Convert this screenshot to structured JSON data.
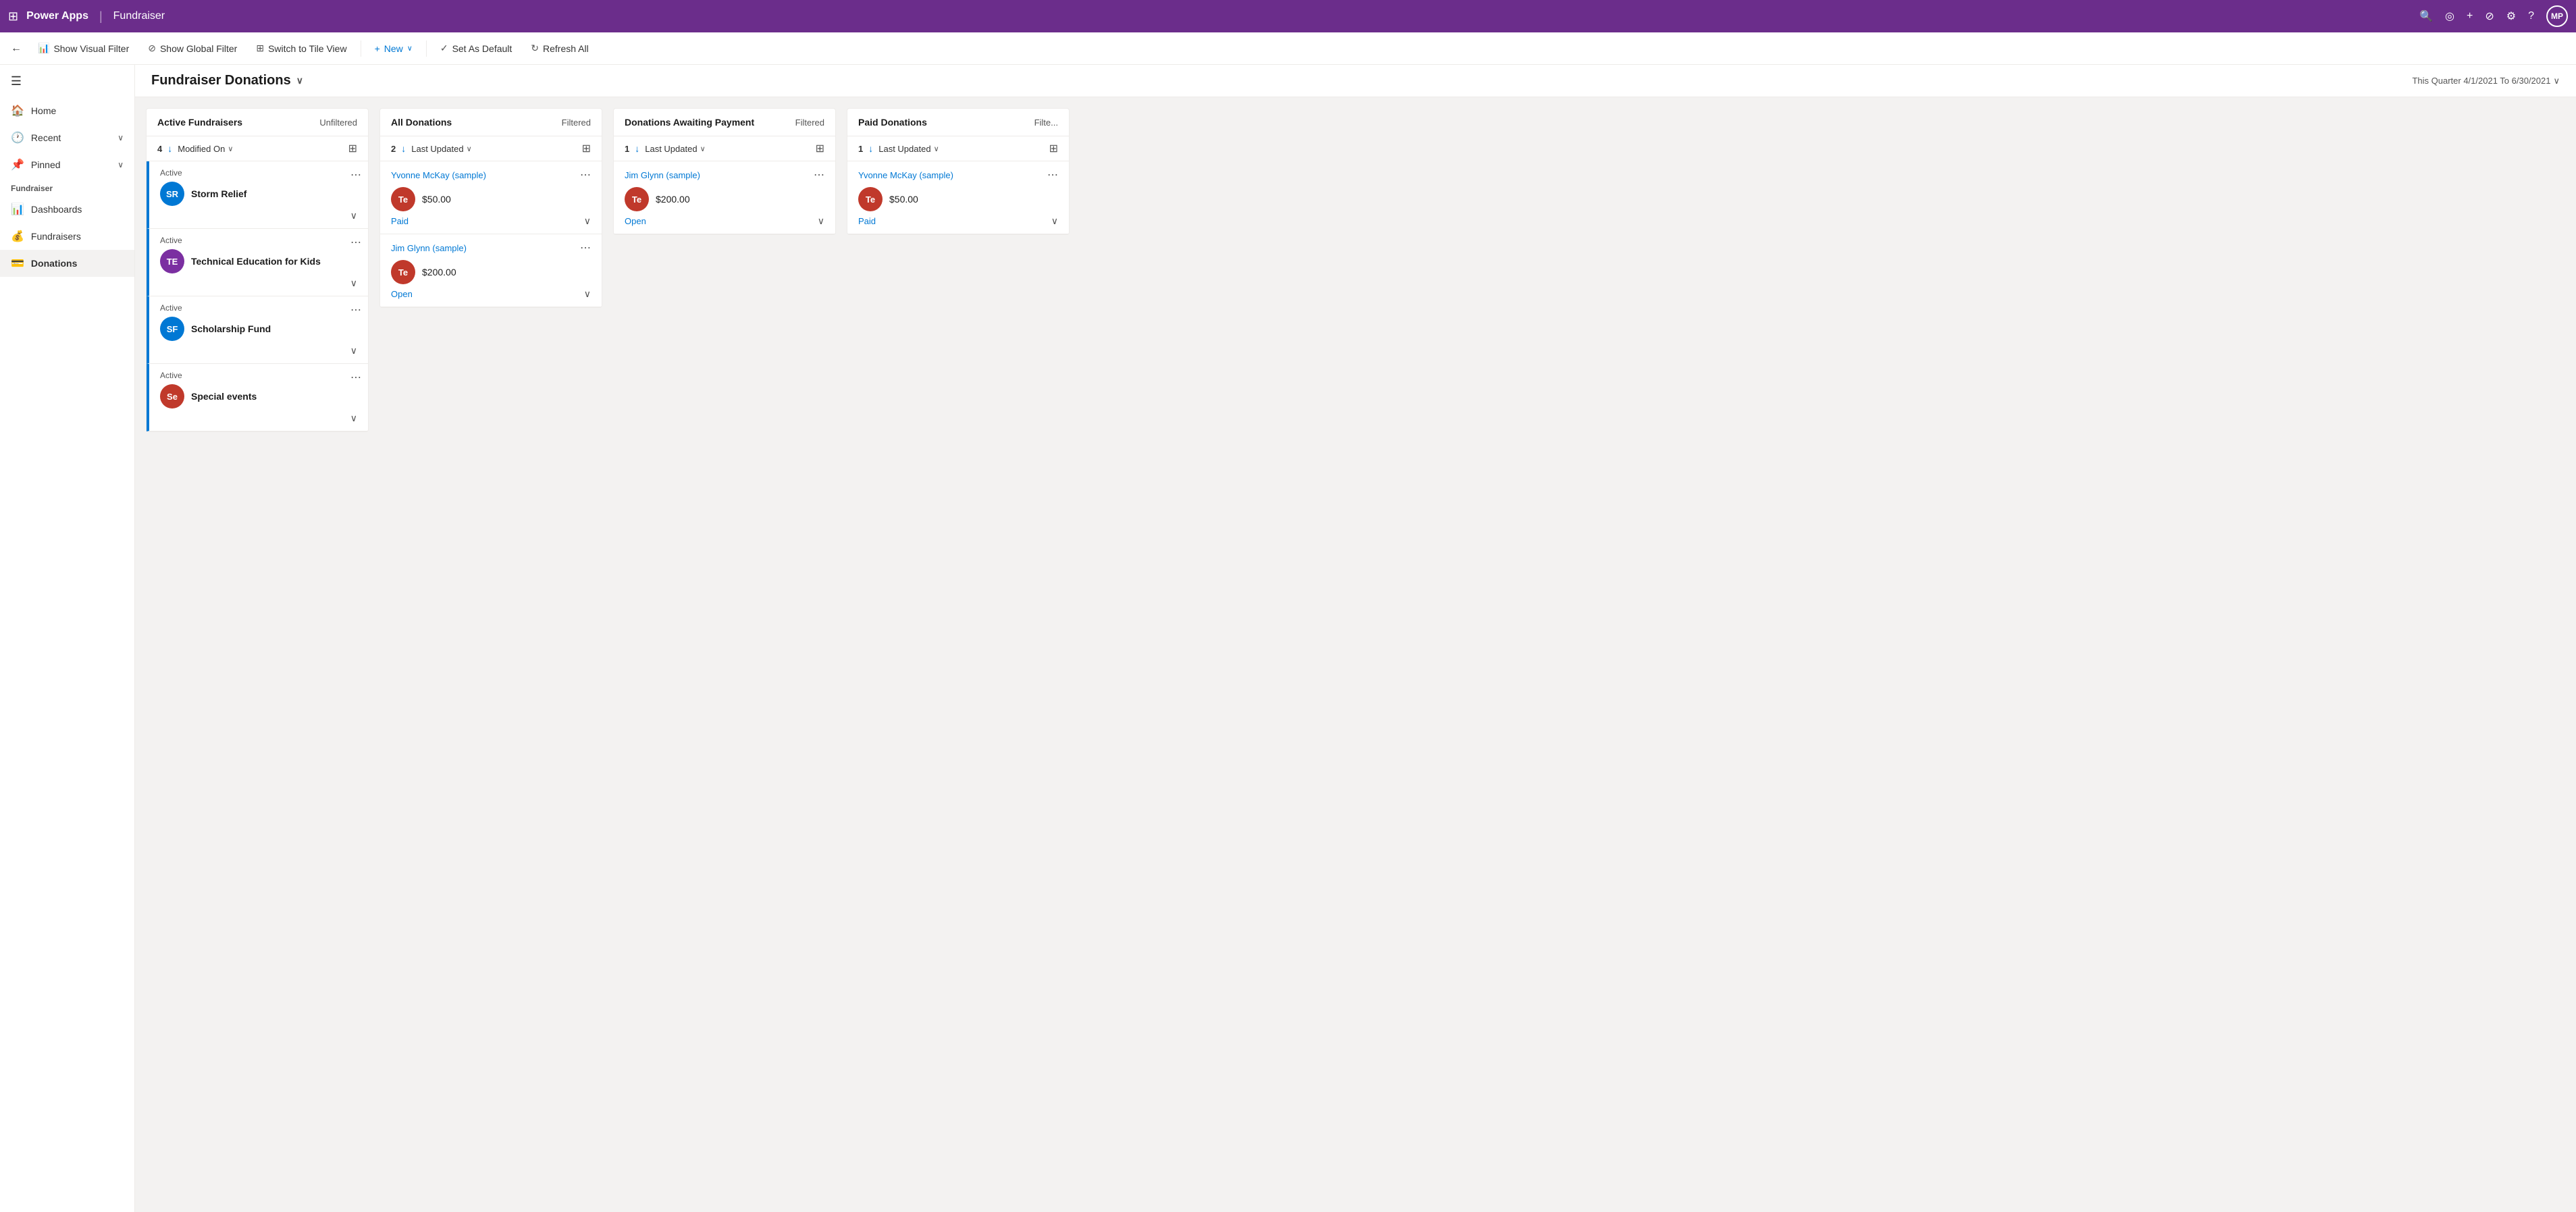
{
  "topbar": {
    "grid_icon": "⊞",
    "app_name": "Power Apps",
    "divider": "|",
    "module": "Fundraiser",
    "icons": {
      "search": "🔍",
      "focus": "◎",
      "add": "+",
      "filter": "⊘",
      "settings": "⚙",
      "help": "?"
    },
    "avatar_label": "MP"
  },
  "toolbar": {
    "back_icon": "←",
    "show_visual_filter": "Show Visual Filter",
    "show_global_filter": "Show Global Filter",
    "switch_to_tile_view": "Switch to Tile View",
    "new_label": "New",
    "dropdown_icon": "∨",
    "set_as_default": "Set As Default",
    "refresh_all": "Refresh All"
  },
  "sidebar": {
    "menu_icon": "☰",
    "nav_items": [
      {
        "icon": "🏠",
        "label": "Home",
        "has_chevron": false
      },
      {
        "icon": "🕐",
        "label": "Recent",
        "has_chevron": true
      },
      {
        "icon": "📌",
        "label": "Pinned",
        "has_chevron": true
      }
    ],
    "section_label": "Fundraiser",
    "section_items": [
      {
        "icon": "📊",
        "label": "Dashboards"
      },
      {
        "icon": "💰",
        "label": "Fundraisers"
      },
      {
        "icon": "💳",
        "label": "Donations"
      }
    ]
  },
  "page": {
    "title": "Fundraiser Donations",
    "title_chevron": "∨",
    "date_range": "This Quarter 4/1/2021 To 6/30/2021",
    "date_chevron": "∨"
  },
  "kanban": {
    "columns": [
      {
        "id": "active-fundraisers",
        "title": "Active Fundraisers",
        "filter_label": "Unfiltered",
        "count": "4",
        "sort_arrow": "↓",
        "sort_field": "Modified On",
        "sort_chevron": "∨",
        "cards": [
          {
            "status": "Active",
            "avatar_bg": "#0078d4",
            "avatar_initials": "SR",
            "title": "Storm Relief"
          },
          {
            "status": "Active",
            "avatar_bg": "#7b2fa1",
            "avatar_initials": "TE",
            "title": "Technical Education for Kids"
          },
          {
            "status": "Active",
            "avatar_bg": "#0078d4",
            "avatar_initials": "SF",
            "title": "Scholarship Fund"
          },
          {
            "status": "Active",
            "avatar_bg": "#c0392b",
            "avatar_initials": "Se",
            "title": "Special events"
          }
        ]
      },
      {
        "id": "all-donations",
        "title": "All Donations",
        "filter_label": "Filtered",
        "count": "2",
        "sort_arrow": "↓",
        "sort_field": "Last Updated",
        "sort_chevron": "∨",
        "donations": [
          {
            "person_name": "Yvonne McKay (sample)",
            "avatar_bg": "#c0392b",
            "avatar_initials": "Te",
            "amount": "$50.00",
            "status": "Paid",
            "status_color": "#0078d4"
          },
          {
            "person_name": "Jim Glynn (sample)",
            "avatar_bg": "#c0392b",
            "avatar_initials": "Te",
            "amount": "$200.00",
            "status": "Open",
            "status_color": "#0078d4"
          }
        ]
      },
      {
        "id": "donations-awaiting-payment",
        "title": "Donations Awaiting Payment",
        "filter_label": "Filtered",
        "count": "1",
        "sort_arrow": "↓",
        "sort_field": "Last Updated",
        "sort_chevron": "∨",
        "donations": [
          {
            "person_name": "Jim Glynn (sample)",
            "avatar_bg": "#c0392b",
            "avatar_initials": "Te",
            "amount": "$200.00",
            "status": "Open",
            "status_color": "#0078d4"
          }
        ]
      },
      {
        "id": "paid-donations",
        "title": "Paid Donations",
        "filter_label": "Filte...",
        "count": "1",
        "sort_arrow": "↓",
        "sort_field": "Last Updated",
        "sort_chevron": "∨",
        "donations": [
          {
            "person_name": "Yvonne McKay (sample)",
            "avatar_bg": "#c0392b",
            "avatar_initials": "Te",
            "amount": "$50.00",
            "status": "Paid",
            "status_color": "#0078d4"
          }
        ]
      }
    ]
  }
}
